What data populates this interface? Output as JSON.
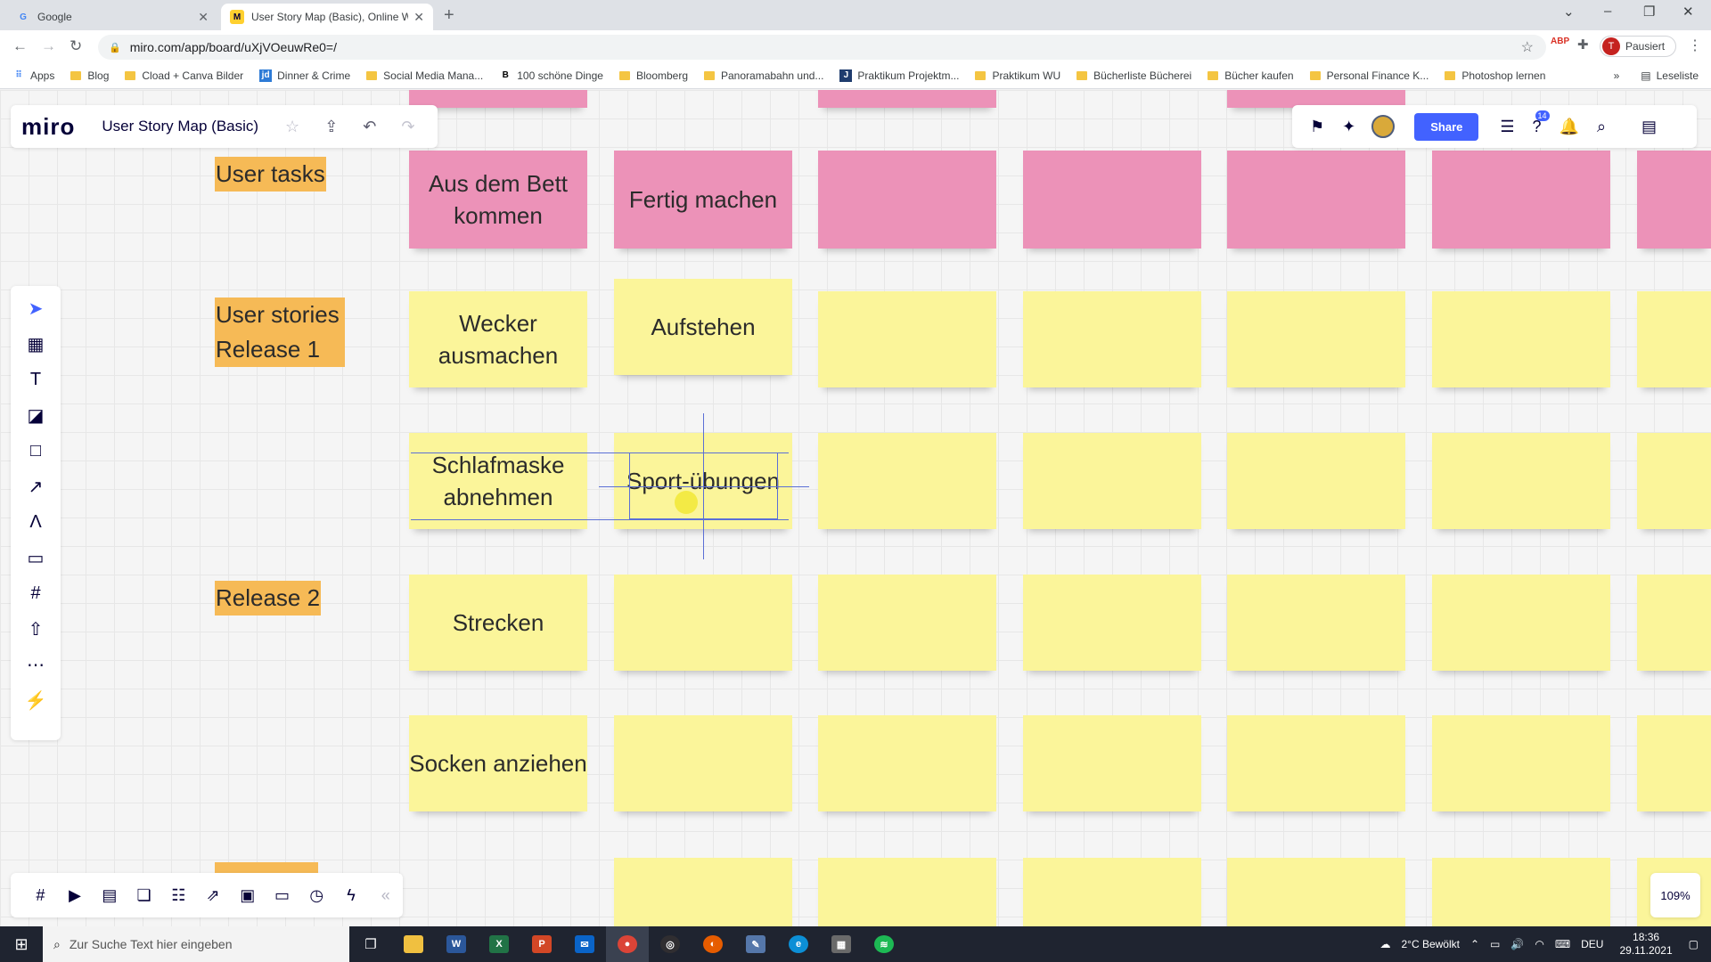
{
  "browser": {
    "tabs": [
      {
        "label": "Google",
        "favicon": "G",
        "active": false
      },
      {
        "label": "User Story Map (Basic), Online W",
        "favicon": "M",
        "active": true
      }
    ],
    "url": "miro.com/app/board/uXjVOeuwRe0=/",
    "profile_initial": "T",
    "profile_status": "Pausiert",
    "extension_label": "ABP",
    "bookmarks": [
      {
        "label": "Apps",
        "icon": "apps-grid-icon"
      },
      {
        "label": "Blog",
        "icon": "folder-icon"
      },
      {
        "label": "Cload + Canva Bilder",
        "icon": "folder-icon"
      },
      {
        "label": "Dinner & Crime",
        "icon": "jimdo-icon"
      },
      {
        "label": "Social Media Mana...",
        "icon": "folder-icon"
      },
      {
        "label": "100 schöne Dinge",
        "icon": "b-icon"
      },
      {
        "label": "Bloomberg",
        "icon": "folder-icon"
      },
      {
        "label": "Panoramabahn und...",
        "icon": "folder-icon"
      },
      {
        "label": "Praktikum Projektm...",
        "icon": "j-icon"
      },
      {
        "label": "Praktikum WU",
        "icon": "folder-icon"
      },
      {
        "label": "Bücherliste Bücherei",
        "icon": "folder-icon"
      },
      {
        "label": "Bücher kaufen",
        "icon": "folder-icon"
      },
      {
        "label": "Personal Finance K...",
        "icon": "folder-icon"
      },
      {
        "label": "Photoshop lernen",
        "icon": "folder-icon"
      }
    ],
    "more_bookmarks": "»",
    "reading_list": "Leseliste"
  },
  "miro": {
    "logo": "miro",
    "board_title": "User Story Map (Basic)",
    "share_label": "Share",
    "notifications_badge": "14",
    "zoom": "109%"
  },
  "board": {
    "labels": {
      "user_tasks": "User tasks",
      "release1": "User stories Release 1",
      "release2": "Release 2"
    },
    "tasks": [
      "Aus dem Bett kommen",
      "Fertig machen",
      "",
      "",
      "",
      "",
      ""
    ],
    "release1_row1": [
      "Wecker ausmachen",
      "Aufstehen",
      "",
      "",
      "",
      "",
      ""
    ],
    "release1_row2": [
      "Schlafmaske abnehmen",
      "Sport-übungen",
      "",
      "",
      "",
      "",
      ""
    ],
    "release2_row1": [
      "Strecken",
      "",
      "",
      "",
      "",
      "",
      ""
    ],
    "release2_row2": [
      "Socken anziehen",
      "",
      "",
      "",
      "",
      "",
      ""
    ]
  },
  "taskbar": {
    "search_placeholder": "Zur Suche Text hier eingeben",
    "weather": "2°C  Bewölkt",
    "language": "DEU",
    "time": "18:36",
    "date": "29.11.2021"
  },
  "colors": {
    "sticky_pink": "#ec92b8",
    "sticky_yellow": "#fbf59a",
    "label_orange": "#f6ba56",
    "miro_blue": "#4262ff"
  }
}
